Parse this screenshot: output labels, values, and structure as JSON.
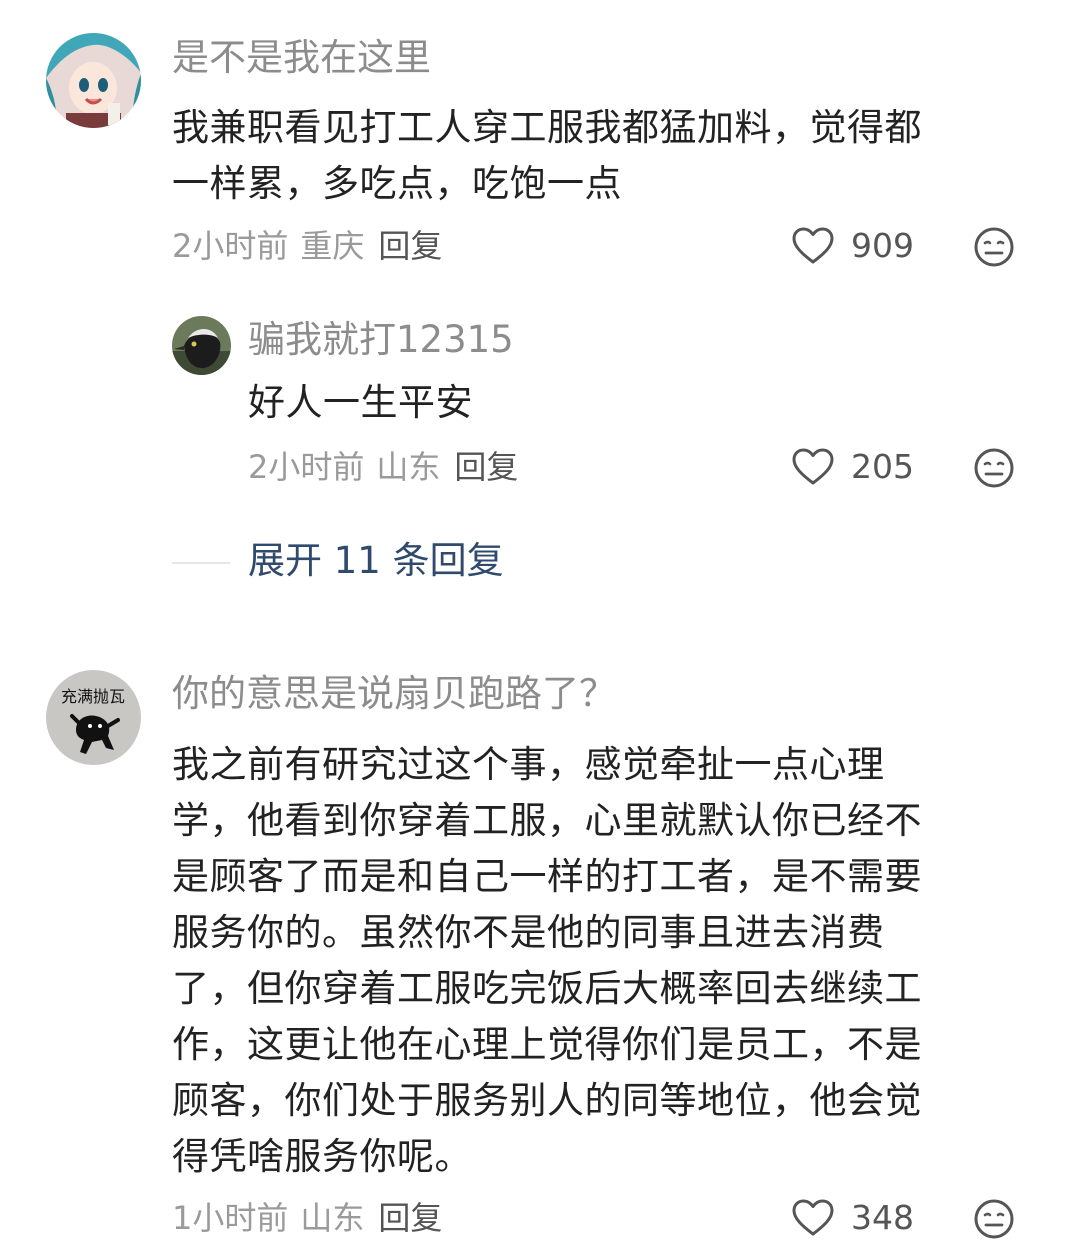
{
  "comments": [
    {
      "username": "是不是我在这里",
      "content_lines": [
        "我兼职看见打工人穿工服我都猛加料，觉得都",
        "一样累，多吃点，吃饱一点"
      ],
      "time": "2小时前",
      "location": "重庆",
      "reply_label": "回复",
      "likes": "909",
      "replies": [
        {
          "username": "骗我就打12315",
          "content_lines": [
            "好人一生平安"
          ],
          "time": "2小时前",
          "location": "山东",
          "reply_label": "回复",
          "likes": "205"
        }
      ],
      "expand_label": "展开 11 条回复"
    },
    {
      "username": "你的意思是说扇贝跑路了？",
      "avatar_text": "充满抛瓦",
      "content_lines": [
        "我之前有研究过这个事，感觉牵扯一点心理",
        "学，他看到你穿着工服，心里就默认你已经不",
        "是顾客了而是和自己一样的打工者，是不需要",
        "服务你的。虽然你不是他的同事且进去消费",
        "了，但你穿着工服吃完饭后大概率回去继续工",
        "作，这更让他在心理上觉得你们是员工，不是",
        "顾客，你们处于服务别人的同等地位，他会觉",
        "得凭啥服务你呢。"
      ],
      "time": "1小时前",
      "location": "山东",
      "reply_label": "回复",
      "likes": "348"
    }
  ],
  "icons": {
    "like": "heart-outline-icon",
    "dislike": "meh-face-icon"
  },
  "colors": {
    "username": "#8c8c8c",
    "text": "#222222",
    "meta": "#9a9a9a",
    "expand": "#2f4a6d"
  }
}
